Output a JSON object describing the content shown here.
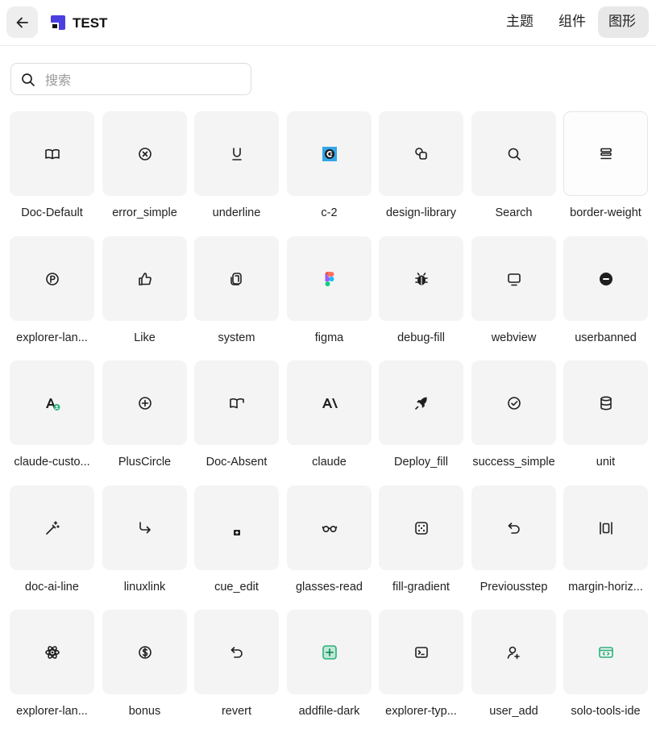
{
  "header": {
    "title": "TEST",
    "tabs": [
      {
        "label": "主题",
        "active": false
      },
      {
        "label": "组件",
        "active": false
      },
      {
        "label": "图形",
        "active": true
      }
    ]
  },
  "search": {
    "placeholder": "搜索",
    "value": ""
  },
  "icons": [
    {
      "label": "Doc-Default",
      "icon": "book-open-icon"
    },
    {
      "label": "error_simple",
      "icon": "x-circle-icon"
    },
    {
      "label": "underline",
      "icon": "underline-icon"
    },
    {
      "label": "c-2",
      "icon": "c-2-logo-icon"
    },
    {
      "label": "design-library",
      "icon": "design-library-icon"
    },
    {
      "label": "Search",
      "icon": "search-icon"
    },
    {
      "label": "border-weight",
      "icon": "border-weight-icon"
    },
    {
      "label": "explorer-lan...",
      "icon": "p-circle-icon"
    },
    {
      "label": "Like",
      "icon": "thumbs-up-icon"
    },
    {
      "label": "system",
      "icon": "system-icon"
    },
    {
      "label": "figma",
      "icon": "figma-icon"
    },
    {
      "label": "debug-fill",
      "icon": "bug-icon"
    },
    {
      "label": "webview",
      "icon": "monitor-icon"
    },
    {
      "label": "userbanned",
      "icon": "minus-circle-icon"
    },
    {
      "label": "claude-custo...",
      "icon": "claude-custom-icon"
    },
    {
      "label": "PlusCircle",
      "icon": "plus-circle-icon"
    },
    {
      "label": "Doc-Absent",
      "icon": "doc-absent-icon"
    },
    {
      "label": "claude",
      "icon": "claude-icon"
    },
    {
      "label": "Deploy_fill",
      "icon": "rocket-icon"
    },
    {
      "label": "success_simple",
      "icon": "check-circle-icon"
    },
    {
      "label": "unit",
      "icon": "database-icon"
    },
    {
      "label": "doc-ai-line",
      "icon": "magic-wand-icon"
    },
    {
      "label": "linuxlink",
      "icon": "corner-down-right-icon"
    },
    {
      "label": "cue_edit",
      "icon": "cue-edit-icon"
    },
    {
      "label": "glasses-read",
      "icon": "glasses-icon"
    },
    {
      "label": "fill-gradient",
      "icon": "dice-icon"
    },
    {
      "label": "Previousstep",
      "icon": "undo-icon"
    },
    {
      "label": "margin-horiz...",
      "icon": "margin-horizontal-icon"
    },
    {
      "label": "explorer-lan...",
      "icon": "atom-icon"
    },
    {
      "label": "bonus",
      "icon": "dollar-circle-icon"
    },
    {
      "label": "revert",
      "icon": "revert-icon"
    },
    {
      "label": "addfile-dark",
      "icon": "add-file-icon"
    },
    {
      "label": "explorer-typ...",
      "icon": "terminal-icon"
    },
    {
      "label": "user_add",
      "icon": "user-add-icon"
    },
    {
      "label": "solo-tools-ide",
      "icon": "ide-icon"
    }
  ],
  "colors": {
    "tile_bg": "#f4f4f4",
    "accent_green": "#2bb07a",
    "logo_blue": "#4b3fe0"
  }
}
